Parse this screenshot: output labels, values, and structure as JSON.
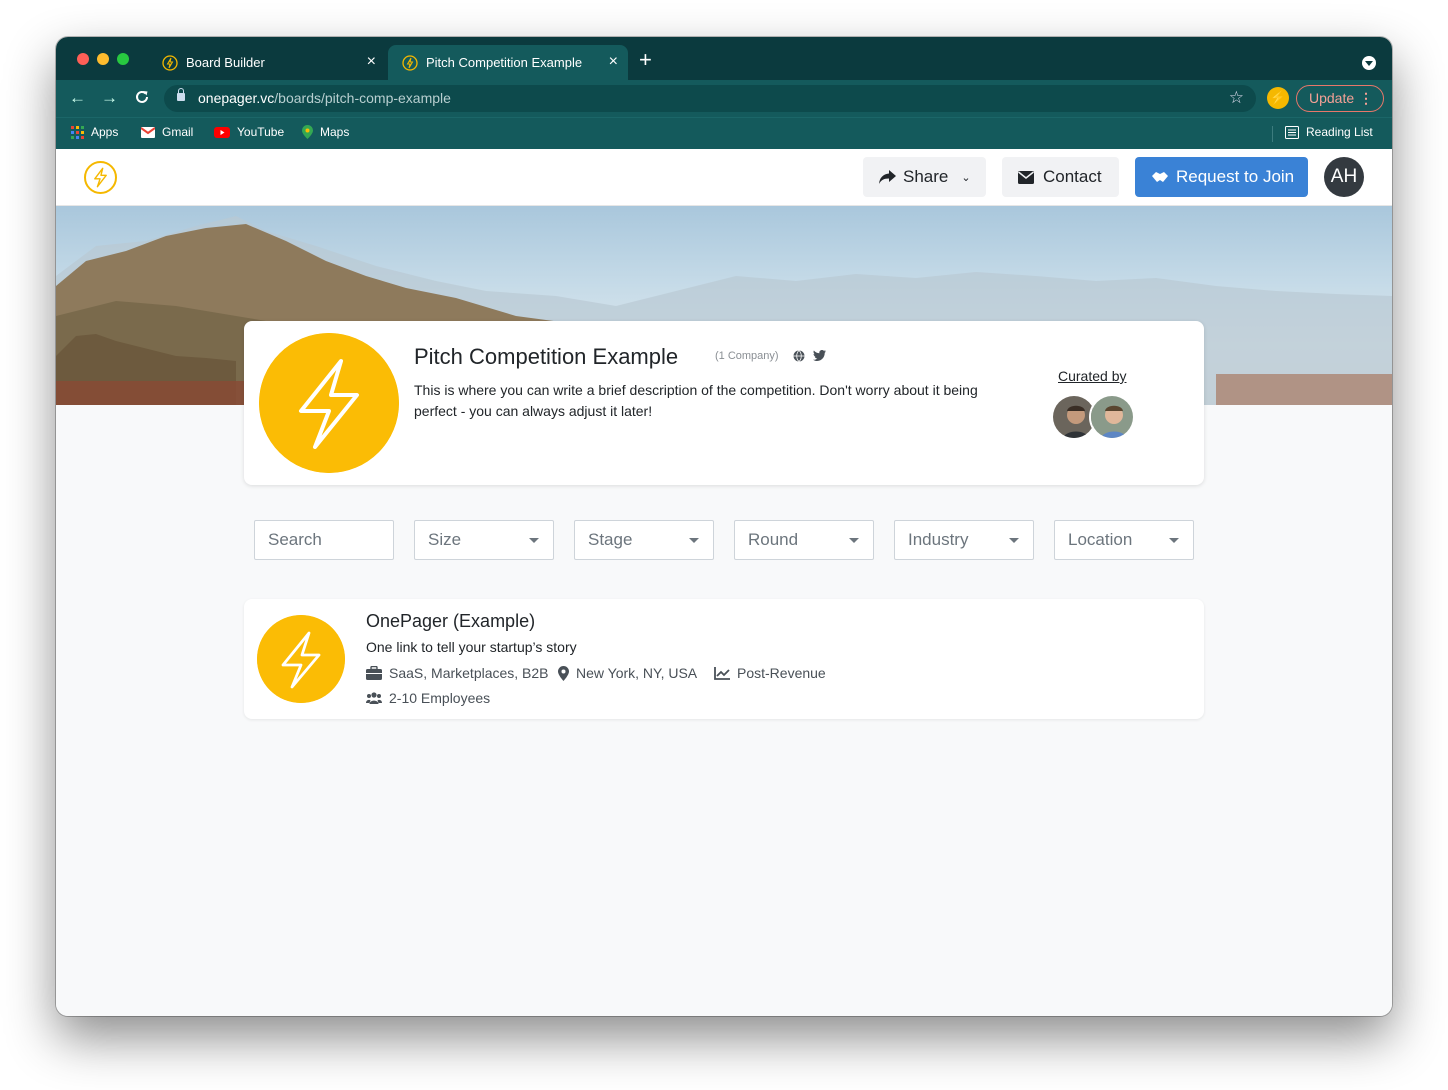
{
  "browser": {
    "tabs": [
      {
        "title": "Board Builder",
        "close": "×"
      },
      {
        "title": "Pitch Competition Example",
        "close": "×"
      }
    ],
    "new_tab": "+",
    "url_host": "onepager.vc",
    "url_path": "/boards/pitch-comp-example",
    "update_label": "Update",
    "bookmarks": {
      "apps": "Apps",
      "gmail": "Gmail",
      "youtube": "YouTube",
      "maps": "Maps",
      "reading_list": "Reading List"
    }
  },
  "nav": {
    "share_label": "Share",
    "contact_label": "Contact",
    "join_label": "Request to Join",
    "avatar_initials": "AH"
  },
  "board": {
    "title": "Pitch Competition Example",
    "company_count": "(1 Company)",
    "description": "This is where you can write a brief description of the competition. Don't worry about it being perfect - you can always adjust it later!",
    "curated_by": "Curated by"
  },
  "filters": {
    "search_placeholder": "Search",
    "selects": [
      "Size",
      "Stage",
      "Round",
      "Industry",
      "Location"
    ]
  },
  "companies": [
    {
      "name": "OnePager (Example)",
      "tagline": "One link to tell your startup’s story",
      "industries": "SaaS, Marketplaces, B2B",
      "location": "New York, NY, USA",
      "stage": "Post-Revenue",
      "size": "2-10 Employees"
    }
  ],
  "colors": {
    "brand_yellow": "#fbbc05",
    "primary_blue": "#3a82d6",
    "browser_chrome": "#145a5c"
  }
}
